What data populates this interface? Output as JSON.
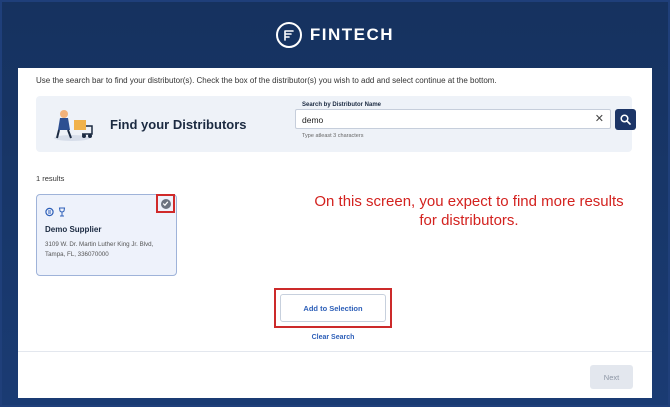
{
  "brand": {
    "name": "FINTECH"
  },
  "instructions": "Use the search bar to find your distributor(s). Check the box of the distributor(s) you wish to add and select continue at the bottom.",
  "search": {
    "title": "Find your Distributors",
    "label": "Search by Distributor Name",
    "value": "demo",
    "hint": "Type atleast 3 characters",
    "clear_icon": "close-icon",
    "search_icon": "search-icon"
  },
  "results": {
    "count_text": "1 results",
    "items": [
      {
        "name": "Demo Supplier",
        "address": "3109 W. Dr. Martin Luther King Jr. Blvd, Tampa, FL, 336070000",
        "selected": true
      }
    ]
  },
  "annotation": "On this screen, you expect to find more results for distributors.",
  "actions": {
    "add_to_selection": "Add to Selection",
    "clear_search": "Clear Search",
    "next": "Next"
  },
  "colors": {
    "header_bg": "#16325f",
    "accent": "#2d5fb8",
    "annotation_red": "#d3221f",
    "search_button": "#1c3567"
  }
}
